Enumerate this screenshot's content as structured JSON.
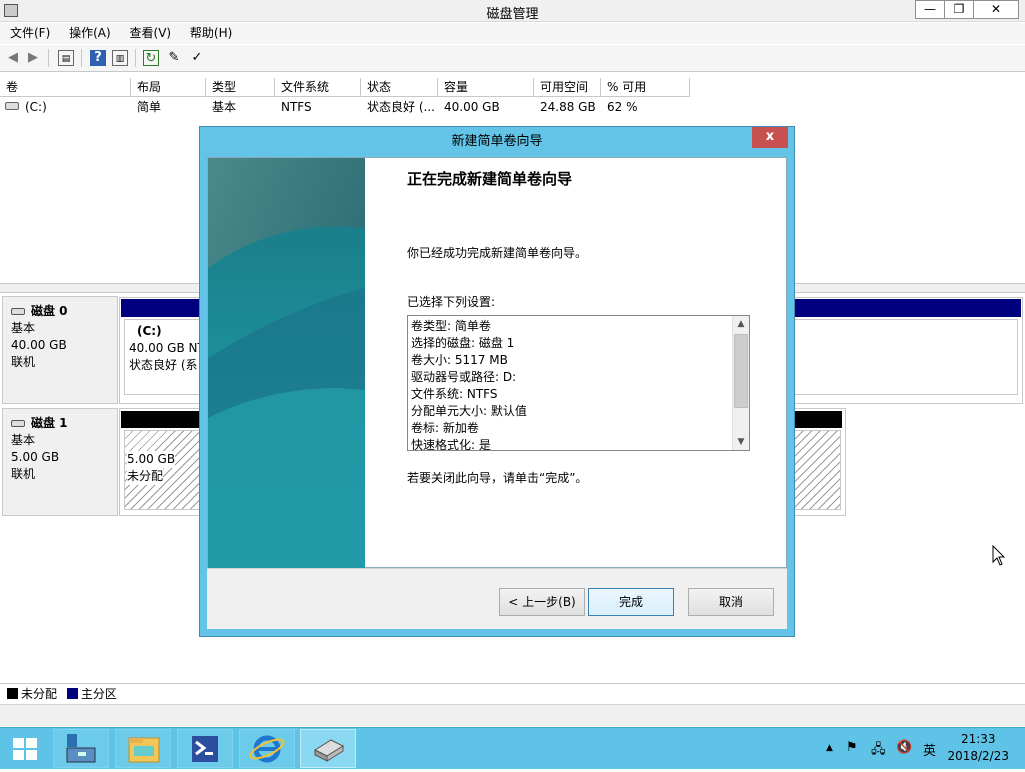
{
  "window": {
    "title": "磁盘管理",
    "minimize": "—",
    "restore": "❐",
    "close": "✕"
  },
  "menu": [
    "文件(F)",
    "操作(A)",
    "查看(V)",
    "帮助(H)"
  ],
  "volume_list": {
    "columns": [
      "卷",
      "布局",
      "类型",
      "文件系统",
      "状态",
      "容量",
      "可用空间",
      "% 可用"
    ],
    "rows": [
      {
        "volume": "(C:)",
        "layout": "简单",
        "type": "基本",
        "fs": "NTFS",
        "status": "状态良好 (...",
        "capacity": "40.00 GB",
        "free": "24.88 GB",
        "pct": "62 %"
      }
    ]
  },
  "disks": [
    {
      "name": "磁盘 0",
      "type": "基本",
      "size": "40.00 GB",
      "state": "联机",
      "volume": {
        "label": "(C:)",
        "line1": "40.00 GB NT",
        "line2": "状态良好 (系"
      }
    },
    {
      "name": "磁盘 1",
      "type": "基本",
      "size": "5.00 GB",
      "state": "联机",
      "volume": {
        "line1": "5.00 GB",
        "line2": "未分配"
      }
    }
  ],
  "legend": {
    "unallocated": "未分配",
    "primary": "主分区",
    "unallocated_color": "#000000",
    "primary_color": "#00007f"
  },
  "dialog": {
    "title": "新建简单卷向导",
    "close": "x",
    "heading": "正在完成新建简单卷向导",
    "intro": "你已经成功完成新建简单卷向导。",
    "settings_label": "已选择下列设置:",
    "settings": [
      "卷类型: 简单卷",
      "选择的磁盘: 磁盘 1",
      "卷大小: 5117 MB",
      "驱动器号或路径: D:",
      "文件系统: NTFS",
      "分配单元大小: 默认值",
      "卷标: 新加卷",
      "快速格式化: 是"
    ],
    "close_hint": "若要关闭此向导，请单击“完成”。",
    "back": "< 上一步(B)",
    "finish": "完成",
    "cancel": "取消"
  },
  "taskbar": {
    "ime": "英",
    "time": "21:33",
    "date": "2018/2/23",
    "accent": "#5ec3e6"
  }
}
